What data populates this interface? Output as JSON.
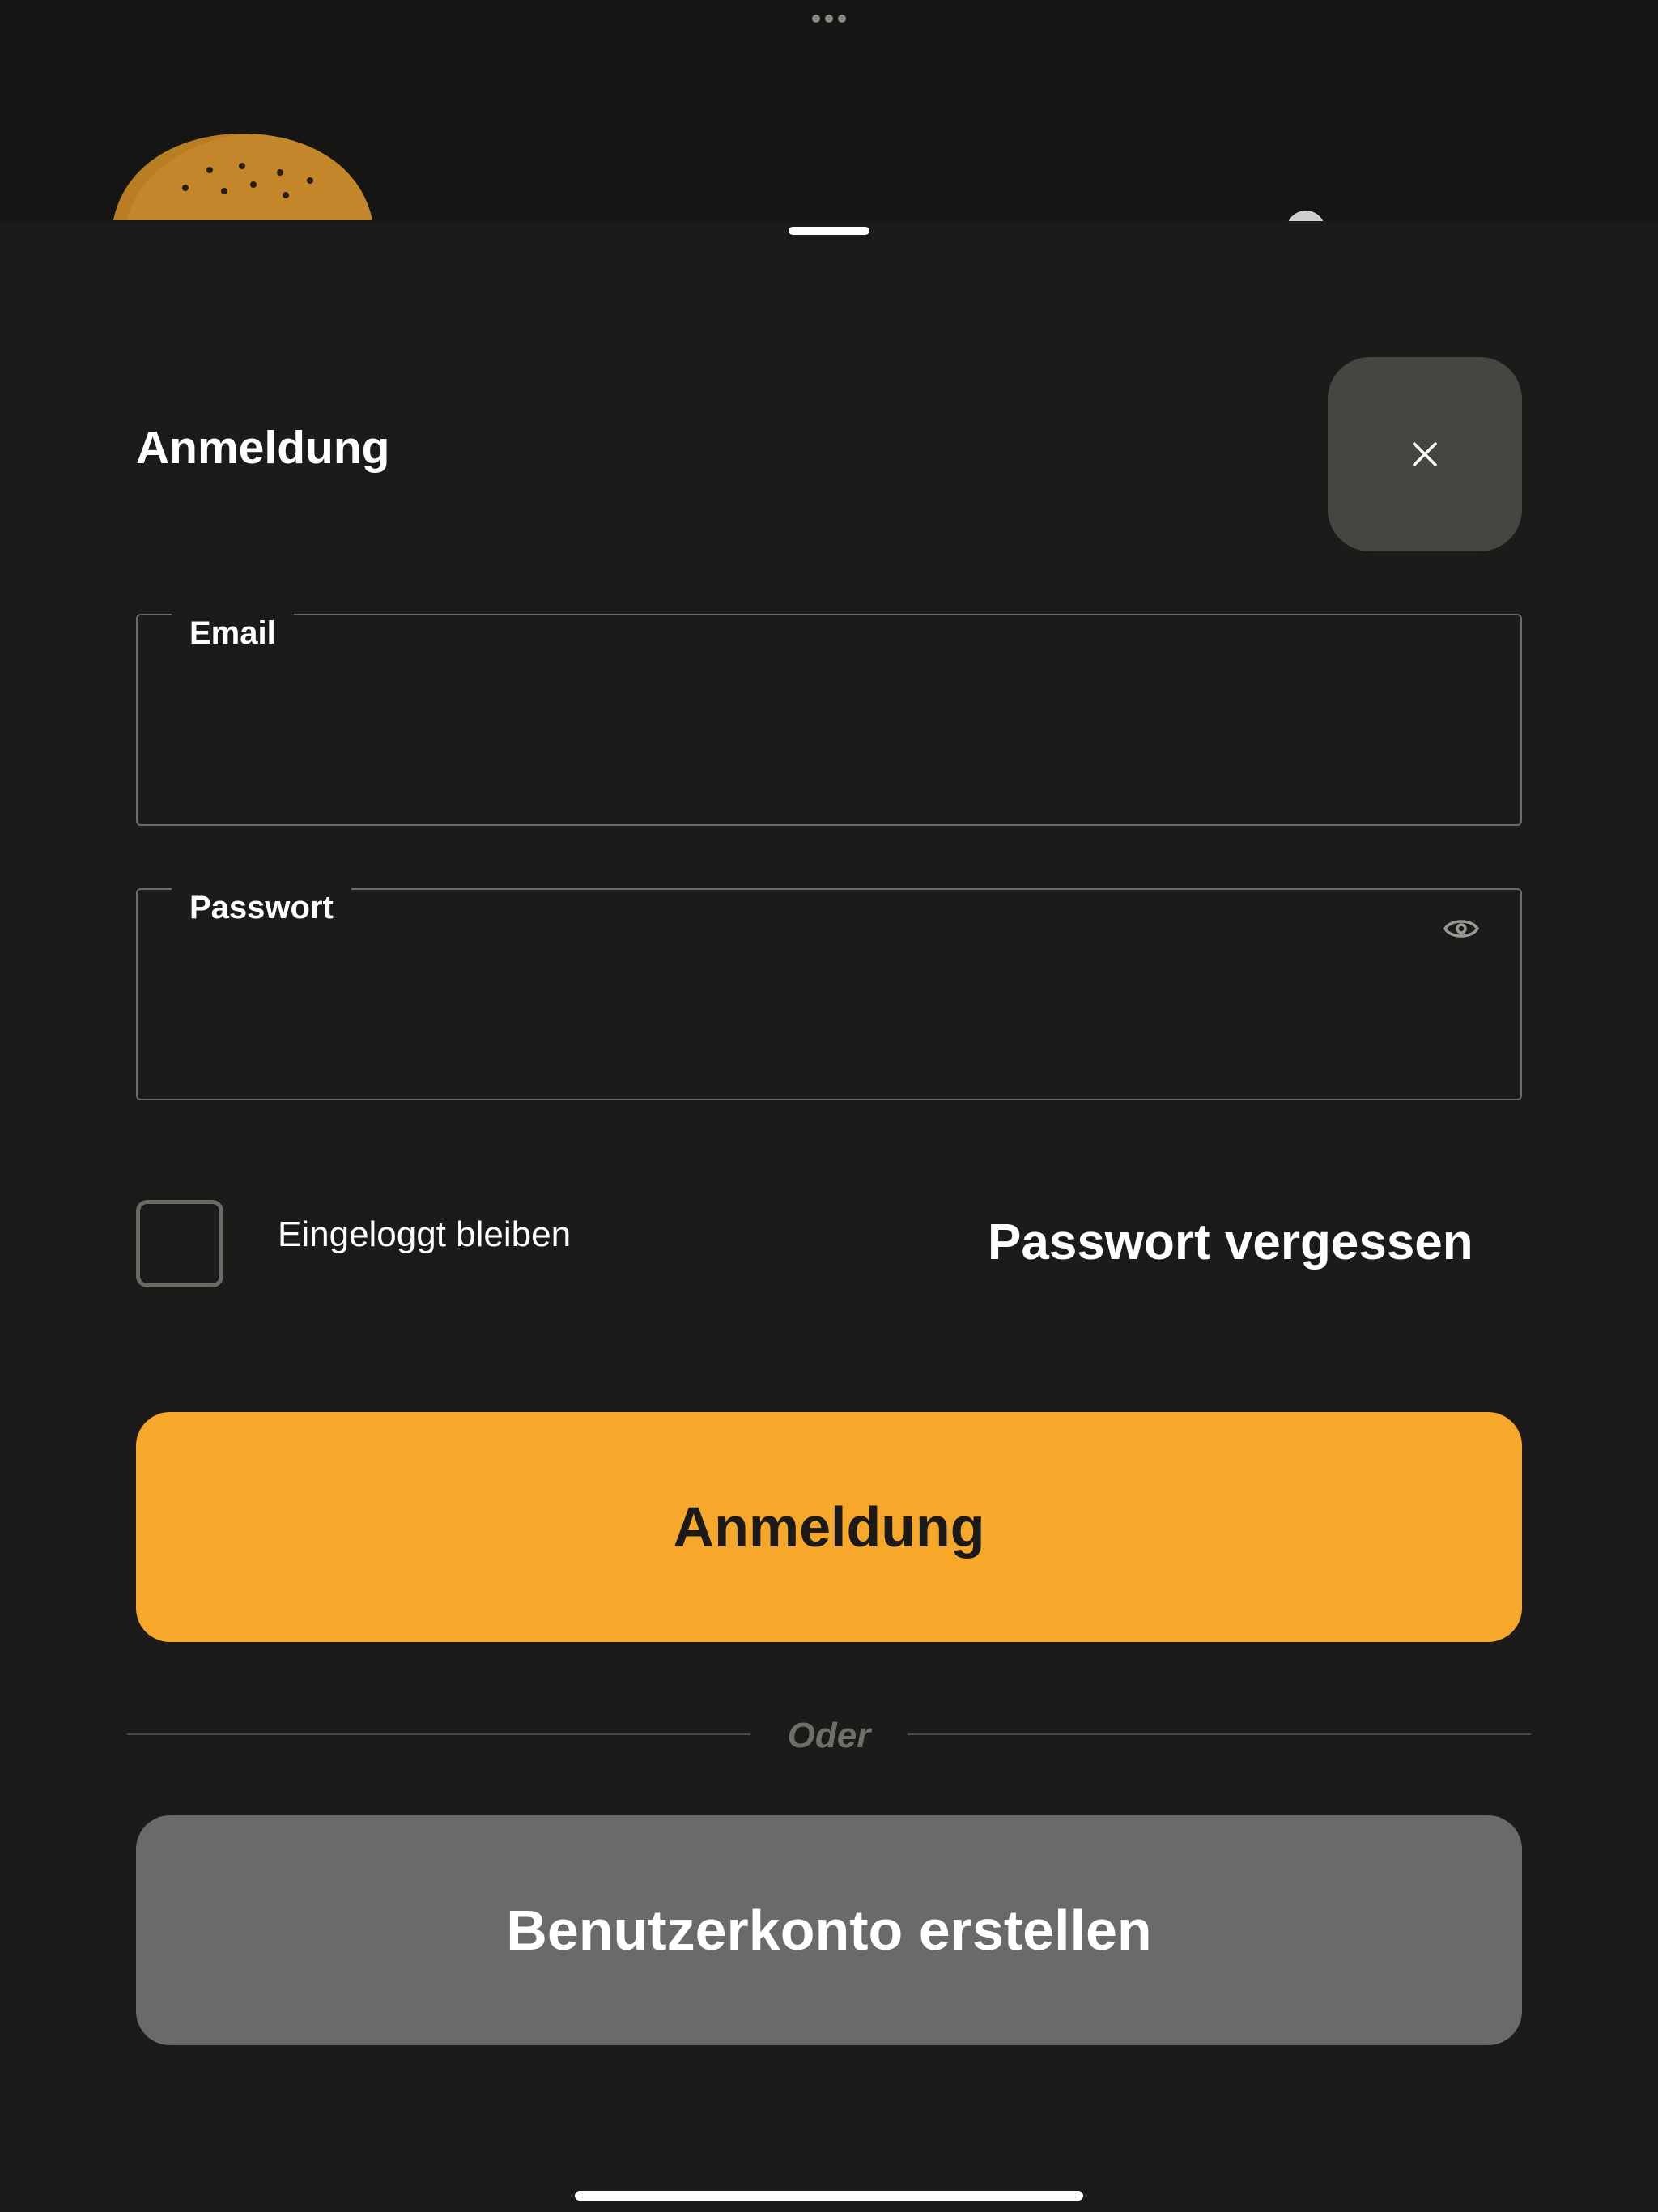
{
  "app": {
    "multitask_icon": "ellipsis-icon",
    "logo_icon": "burger-bun-logo",
    "background_icon": "user-avatar-icon"
  },
  "sheet": {
    "title": "Anmeldung",
    "close_icon": "close-icon"
  },
  "form": {
    "email": {
      "label": "Email",
      "value": "",
      "placeholder": ""
    },
    "password": {
      "label": "Passwort",
      "value": "",
      "placeholder": "",
      "toggle_icon": "eye-icon"
    },
    "remember": {
      "label": "Eingeloggt bleiben",
      "checked": false
    },
    "forgot_label": "Passwort vergessen"
  },
  "actions": {
    "login_label": "Anmeldung",
    "divider_label": "Oder",
    "register_label": "Benutzerkonto erstellen"
  },
  "colors": {
    "background": "#151513",
    "sheet": "#1c1b19",
    "accent": "#f7a82a",
    "secondary_button": "#6a6a68",
    "close_button": "#464542",
    "bun": "#c4862a"
  }
}
